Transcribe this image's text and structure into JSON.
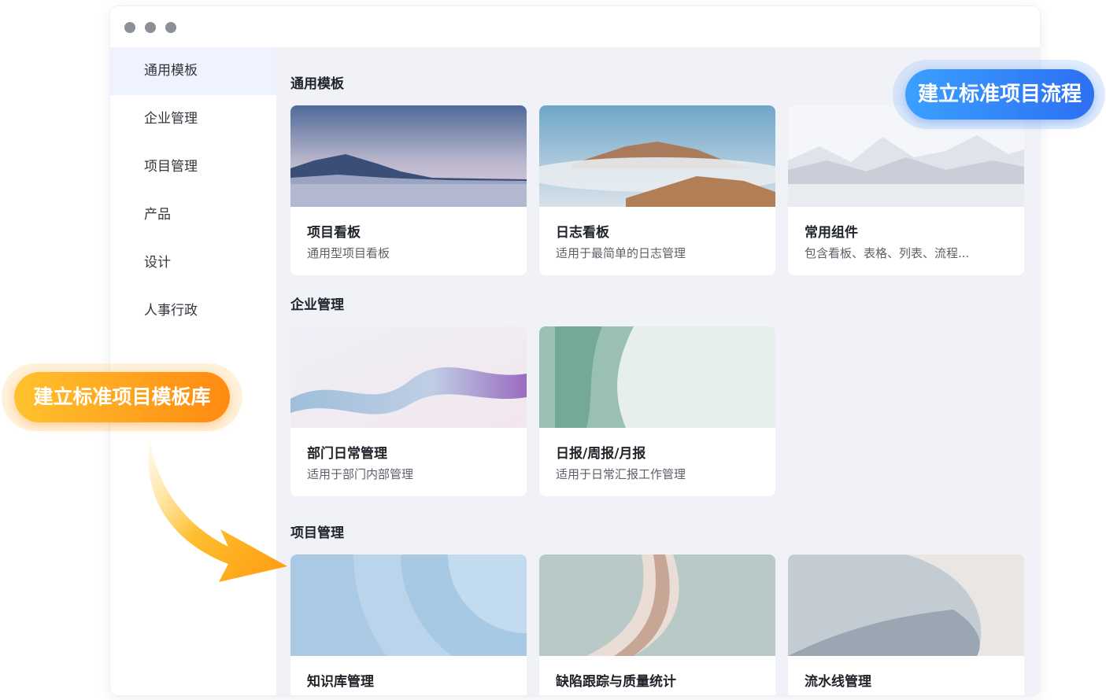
{
  "sidebar": {
    "items": [
      {
        "label": "通用模板",
        "active": true
      },
      {
        "label": "企业管理"
      },
      {
        "label": "项目管理"
      },
      {
        "label": "产品"
      },
      {
        "label": "设计"
      },
      {
        "label": "人事行政"
      }
    ]
  },
  "sections": [
    {
      "title": "通用模板",
      "cards": [
        {
          "title": "项目看板",
          "desc": "通用型项目看板"
        },
        {
          "title": "日志看板",
          "desc": "适用于最简单的日志管理"
        },
        {
          "title": "常用组件",
          "desc": "包含看板、表格、列表、流程..."
        }
      ]
    },
    {
      "title": "企业管理",
      "cards": [
        {
          "title": "部门日常管理",
          "desc": "适用于部门内部管理"
        },
        {
          "title": "日报/周报/月报",
          "desc": "适用于日常汇报工作管理"
        }
      ]
    },
    {
      "title": "项目管理",
      "cards": [
        {
          "title": "知识库管理"
        },
        {
          "title": "缺陷跟踪与质量统计"
        },
        {
          "title": "流水线管理"
        }
      ]
    }
  ],
  "callouts": {
    "process": "建立标准项目流程",
    "library": "建立标准项目模板库"
  },
  "colors": {
    "accent_blue": "#2d6ff2",
    "accent_orange": "#ff8a12",
    "sidebar_active": "#eef3fd",
    "content_bg": "#f1f2f7"
  }
}
